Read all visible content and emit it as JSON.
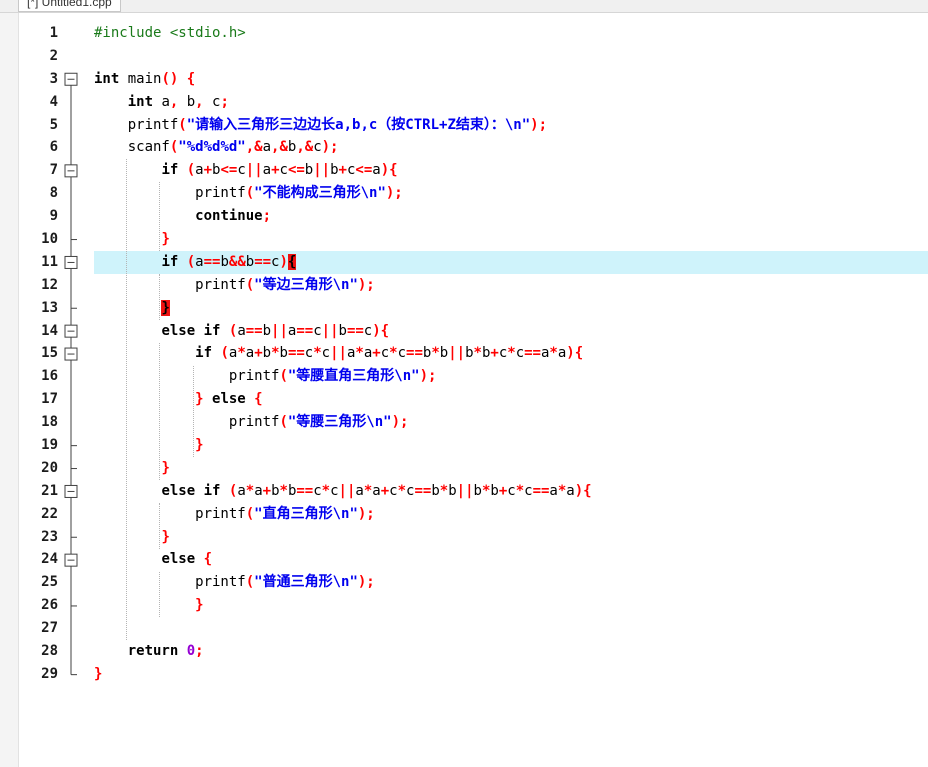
{
  "tab": {
    "label": "[*] Untitled1.cpp"
  },
  "editor": {
    "lines": [
      {
        "n": "1",
        "fold": "none",
        "tokens": [
          {
            "t": "#include <stdio.h>",
            "c": "pp"
          }
        ]
      },
      {
        "n": "2",
        "fold": "line",
        "tokens": []
      },
      {
        "n": "3",
        "fold": "open-top",
        "tokens": [
          {
            "t": "int",
            "c": "kw"
          },
          {
            "t": " main",
            "c": "pl"
          },
          {
            "t": "() {",
            "c": "op"
          }
        ]
      },
      {
        "n": "4",
        "fold": "line",
        "tokens": [
          {
            "t": "    ",
            "c": "pl"
          },
          {
            "t": "int",
            "c": "kw"
          },
          {
            "t": " a",
            "c": "pl"
          },
          {
            "t": ",",
            "c": "op"
          },
          {
            "t": " b",
            "c": "pl"
          },
          {
            "t": ",",
            "c": "op"
          },
          {
            "t": " c",
            "c": "pl"
          },
          {
            "t": ";",
            "c": "op"
          }
        ]
      },
      {
        "n": "5",
        "fold": "line",
        "tokens": [
          {
            "t": "    printf",
            "c": "pl"
          },
          {
            "t": "(",
            "c": "op"
          },
          {
            "t": "\"请输入三角形三边边长a,b,c（按CTRL+Z结束）：\\n\"",
            "c": "str"
          },
          {
            "t": ");",
            "c": "op"
          }
        ]
      },
      {
        "n": "6",
        "fold": "line",
        "tokens": [
          {
            "t": "    scanf",
            "c": "pl"
          },
          {
            "t": "(",
            "c": "op"
          },
          {
            "t": "\"%d%d%d\"",
            "c": "str"
          },
          {
            "t": ",&",
            "c": "op"
          },
          {
            "t": "a",
            "c": "pl"
          },
          {
            "t": ",&",
            "c": "op"
          },
          {
            "t": "b",
            "c": "pl"
          },
          {
            "t": ",&",
            "c": "op"
          },
          {
            "t": "c",
            "c": "pl"
          },
          {
            "t": ");",
            "c": "op"
          }
        ]
      },
      {
        "n": "7",
        "fold": "open",
        "tokens": [
          {
            "t": "        ",
            "c": "pl"
          },
          {
            "t": "if",
            "c": "kw"
          },
          {
            "t": " (",
            "c": "op"
          },
          {
            "t": "a",
            "c": "pl"
          },
          {
            "t": "+",
            "c": "op"
          },
          {
            "t": "b",
            "c": "pl"
          },
          {
            "t": "<=",
            "c": "op"
          },
          {
            "t": "c",
            "c": "pl"
          },
          {
            "t": "||",
            "c": "op"
          },
          {
            "t": "a",
            "c": "pl"
          },
          {
            "t": "+",
            "c": "op"
          },
          {
            "t": "c",
            "c": "pl"
          },
          {
            "t": "<=",
            "c": "op"
          },
          {
            "t": "b",
            "c": "pl"
          },
          {
            "t": "||",
            "c": "op"
          },
          {
            "t": "b",
            "c": "pl"
          },
          {
            "t": "+",
            "c": "op"
          },
          {
            "t": "c",
            "c": "pl"
          },
          {
            "t": "<=",
            "c": "op"
          },
          {
            "t": "a",
            "c": "pl"
          },
          {
            "t": "){",
            "c": "op"
          }
        ]
      },
      {
        "n": "8",
        "fold": "line",
        "tokens": [
          {
            "t": "            printf",
            "c": "pl"
          },
          {
            "t": "(",
            "c": "op"
          },
          {
            "t": "\"不能构成三角形\\n\"",
            "c": "str"
          },
          {
            "t": ");",
            "c": "op"
          }
        ]
      },
      {
        "n": "9",
        "fold": "line",
        "tokens": [
          {
            "t": "            ",
            "c": "pl"
          },
          {
            "t": "continue",
            "c": "kw"
          },
          {
            "t": ";",
            "c": "op"
          }
        ]
      },
      {
        "n": "10",
        "fold": "end",
        "tokens": [
          {
            "t": "        ",
            "c": "pl"
          },
          {
            "t": "}",
            "c": "op"
          }
        ]
      },
      {
        "n": "11",
        "fold": "open",
        "hl": true,
        "tokens": [
          {
            "t": "        ",
            "c": "pl"
          },
          {
            "t": "if",
            "c": "kw"
          },
          {
            "t": " (",
            "c": "op"
          },
          {
            "t": "a",
            "c": "pl"
          },
          {
            "t": "==",
            "c": "op"
          },
          {
            "t": "b",
            "c": "pl"
          },
          {
            "t": "&&",
            "c": "op"
          },
          {
            "t": "b",
            "c": "pl"
          },
          {
            "t": "==",
            "c": "op"
          },
          {
            "t": "c",
            "c": "pl"
          },
          {
            "t": ")",
            "c": "op"
          },
          {
            "t": "{",
            "c": "br"
          }
        ]
      },
      {
        "n": "12",
        "fold": "line",
        "tokens": [
          {
            "t": "            printf",
            "c": "pl"
          },
          {
            "t": "(",
            "c": "op"
          },
          {
            "t": "\"等边三角形\\n\"",
            "c": "str"
          },
          {
            "t": ");",
            "c": "op"
          }
        ]
      },
      {
        "n": "13",
        "fold": "end",
        "tokens": [
          {
            "t": "        ",
            "c": "pl"
          },
          {
            "t": "}",
            "c": "br"
          }
        ]
      },
      {
        "n": "14",
        "fold": "open",
        "tokens": [
          {
            "t": "        ",
            "c": "pl"
          },
          {
            "t": "else if",
            "c": "kw"
          },
          {
            "t": " (",
            "c": "op"
          },
          {
            "t": "a",
            "c": "pl"
          },
          {
            "t": "==",
            "c": "op"
          },
          {
            "t": "b",
            "c": "pl"
          },
          {
            "t": "||",
            "c": "op"
          },
          {
            "t": "a",
            "c": "pl"
          },
          {
            "t": "==",
            "c": "op"
          },
          {
            "t": "c",
            "c": "pl"
          },
          {
            "t": "||",
            "c": "op"
          },
          {
            "t": "b",
            "c": "pl"
          },
          {
            "t": "==",
            "c": "op"
          },
          {
            "t": "c",
            "c": "pl"
          },
          {
            "t": "){",
            "c": "op"
          }
        ]
      },
      {
        "n": "15",
        "fold": "open",
        "tokens": [
          {
            "t": "            ",
            "c": "pl"
          },
          {
            "t": "if",
            "c": "kw"
          },
          {
            "t": " (",
            "c": "op"
          },
          {
            "t": "a",
            "c": "pl"
          },
          {
            "t": "*",
            "c": "op"
          },
          {
            "t": "a",
            "c": "pl"
          },
          {
            "t": "+",
            "c": "op"
          },
          {
            "t": "b",
            "c": "pl"
          },
          {
            "t": "*",
            "c": "op"
          },
          {
            "t": "b",
            "c": "pl"
          },
          {
            "t": "==",
            "c": "op"
          },
          {
            "t": "c",
            "c": "pl"
          },
          {
            "t": "*",
            "c": "op"
          },
          {
            "t": "c",
            "c": "pl"
          },
          {
            "t": "||",
            "c": "op"
          },
          {
            "t": "a",
            "c": "pl"
          },
          {
            "t": "*",
            "c": "op"
          },
          {
            "t": "a",
            "c": "pl"
          },
          {
            "t": "+",
            "c": "op"
          },
          {
            "t": "c",
            "c": "pl"
          },
          {
            "t": "*",
            "c": "op"
          },
          {
            "t": "c",
            "c": "pl"
          },
          {
            "t": "==",
            "c": "op"
          },
          {
            "t": "b",
            "c": "pl"
          },
          {
            "t": "*",
            "c": "op"
          },
          {
            "t": "b",
            "c": "pl"
          },
          {
            "t": "||",
            "c": "op"
          },
          {
            "t": "b",
            "c": "pl"
          },
          {
            "t": "*",
            "c": "op"
          },
          {
            "t": "b",
            "c": "pl"
          },
          {
            "t": "+",
            "c": "op"
          },
          {
            "t": "c",
            "c": "pl"
          },
          {
            "t": "*",
            "c": "op"
          },
          {
            "t": "c",
            "c": "pl"
          },
          {
            "t": "==",
            "c": "op"
          },
          {
            "t": "a",
            "c": "pl"
          },
          {
            "t": "*",
            "c": "op"
          },
          {
            "t": "a",
            "c": "pl"
          },
          {
            "t": "){",
            "c": "op"
          }
        ]
      },
      {
        "n": "16",
        "fold": "line",
        "tokens": [
          {
            "t": "                printf",
            "c": "pl"
          },
          {
            "t": "(",
            "c": "op"
          },
          {
            "t": "\"等腰直角三角形\\n\"",
            "c": "str"
          },
          {
            "t": ");",
            "c": "op"
          }
        ]
      },
      {
        "n": "17",
        "fold": "line",
        "tokens": [
          {
            "t": "            ",
            "c": "pl"
          },
          {
            "t": "}",
            "c": "op"
          },
          {
            "t": " else ",
            "c": "kw"
          },
          {
            "t": "{",
            "c": "op"
          }
        ]
      },
      {
        "n": "18",
        "fold": "line",
        "tokens": [
          {
            "t": "                printf",
            "c": "pl"
          },
          {
            "t": "(",
            "c": "op"
          },
          {
            "t": "\"等腰三角形\\n\"",
            "c": "str"
          },
          {
            "t": ");",
            "c": "op"
          }
        ]
      },
      {
        "n": "19",
        "fold": "end",
        "tokens": [
          {
            "t": "            ",
            "c": "pl"
          },
          {
            "t": "}",
            "c": "op"
          }
        ]
      },
      {
        "n": "20",
        "fold": "end",
        "tokens": [
          {
            "t": "        ",
            "c": "pl"
          },
          {
            "t": "}",
            "c": "op"
          }
        ]
      },
      {
        "n": "21",
        "fold": "open",
        "tokens": [
          {
            "t": "        ",
            "c": "pl"
          },
          {
            "t": "else if",
            "c": "kw"
          },
          {
            "t": " (",
            "c": "op"
          },
          {
            "t": "a",
            "c": "pl"
          },
          {
            "t": "*",
            "c": "op"
          },
          {
            "t": "a",
            "c": "pl"
          },
          {
            "t": "+",
            "c": "op"
          },
          {
            "t": "b",
            "c": "pl"
          },
          {
            "t": "*",
            "c": "op"
          },
          {
            "t": "b",
            "c": "pl"
          },
          {
            "t": "==",
            "c": "op"
          },
          {
            "t": "c",
            "c": "pl"
          },
          {
            "t": "*",
            "c": "op"
          },
          {
            "t": "c",
            "c": "pl"
          },
          {
            "t": "||",
            "c": "op"
          },
          {
            "t": "a",
            "c": "pl"
          },
          {
            "t": "*",
            "c": "op"
          },
          {
            "t": "a",
            "c": "pl"
          },
          {
            "t": "+",
            "c": "op"
          },
          {
            "t": "c",
            "c": "pl"
          },
          {
            "t": "*",
            "c": "op"
          },
          {
            "t": "c",
            "c": "pl"
          },
          {
            "t": "==",
            "c": "op"
          },
          {
            "t": "b",
            "c": "pl"
          },
          {
            "t": "*",
            "c": "op"
          },
          {
            "t": "b",
            "c": "pl"
          },
          {
            "t": "||",
            "c": "op"
          },
          {
            "t": "b",
            "c": "pl"
          },
          {
            "t": "*",
            "c": "op"
          },
          {
            "t": "b",
            "c": "pl"
          },
          {
            "t": "+",
            "c": "op"
          },
          {
            "t": "c",
            "c": "pl"
          },
          {
            "t": "*",
            "c": "op"
          },
          {
            "t": "c",
            "c": "pl"
          },
          {
            "t": "==",
            "c": "op"
          },
          {
            "t": "a",
            "c": "pl"
          },
          {
            "t": "*",
            "c": "op"
          },
          {
            "t": "a",
            "c": "pl"
          },
          {
            "t": "){",
            "c": "op"
          }
        ]
      },
      {
        "n": "22",
        "fold": "line",
        "tokens": [
          {
            "t": "            printf",
            "c": "pl"
          },
          {
            "t": "(",
            "c": "op"
          },
          {
            "t": "\"直角三角形\\n\"",
            "c": "str"
          },
          {
            "t": ");",
            "c": "op"
          }
        ]
      },
      {
        "n": "23",
        "fold": "end",
        "tokens": [
          {
            "t": "        ",
            "c": "pl"
          },
          {
            "t": "}",
            "c": "op"
          }
        ]
      },
      {
        "n": "24",
        "fold": "open",
        "tokens": [
          {
            "t": "        ",
            "c": "pl"
          },
          {
            "t": "else",
            "c": "kw"
          },
          {
            "t": " {",
            "c": "op"
          }
        ]
      },
      {
        "n": "25",
        "fold": "line",
        "tokens": [
          {
            "t": "            printf",
            "c": "pl"
          },
          {
            "t": "(",
            "c": "op"
          },
          {
            "t": "\"普通三角形\\n\"",
            "c": "str"
          },
          {
            "t": ");",
            "c": "op"
          }
        ]
      },
      {
        "n": "26",
        "fold": "end",
        "tokens": [
          {
            "t": "            ",
            "c": "pl"
          },
          {
            "t": "}",
            "c": "op"
          }
        ]
      },
      {
        "n": "27",
        "fold": "line",
        "tokens": []
      },
      {
        "n": "28",
        "fold": "line",
        "tokens": [
          {
            "t": "    ",
            "c": "pl"
          },
          {
            "t": "return",
            "c": "kw"
          },
          {
            "t": " ",
            "c": "pl"
          },
          {
            "t": "0",
            "c": "num"
          },
          {
            "t": ";",
            "c": "op"
          }
        ]
      },
      {
        "n": "29",
        "fold": "last",
        "tokens": [
          {
            "t": "}",
            "c": "op"
          }
        ]
      }
    ]
  },
  "colors": {
    "current_line": "#cff3fb",
    "brace_match": "#ee1111",
    "string": "#0000ee",
    "symbol": "#ff0000",
    "preprocessor": "#1a7a1a",
    "number": "#9400d3"
  }
}
